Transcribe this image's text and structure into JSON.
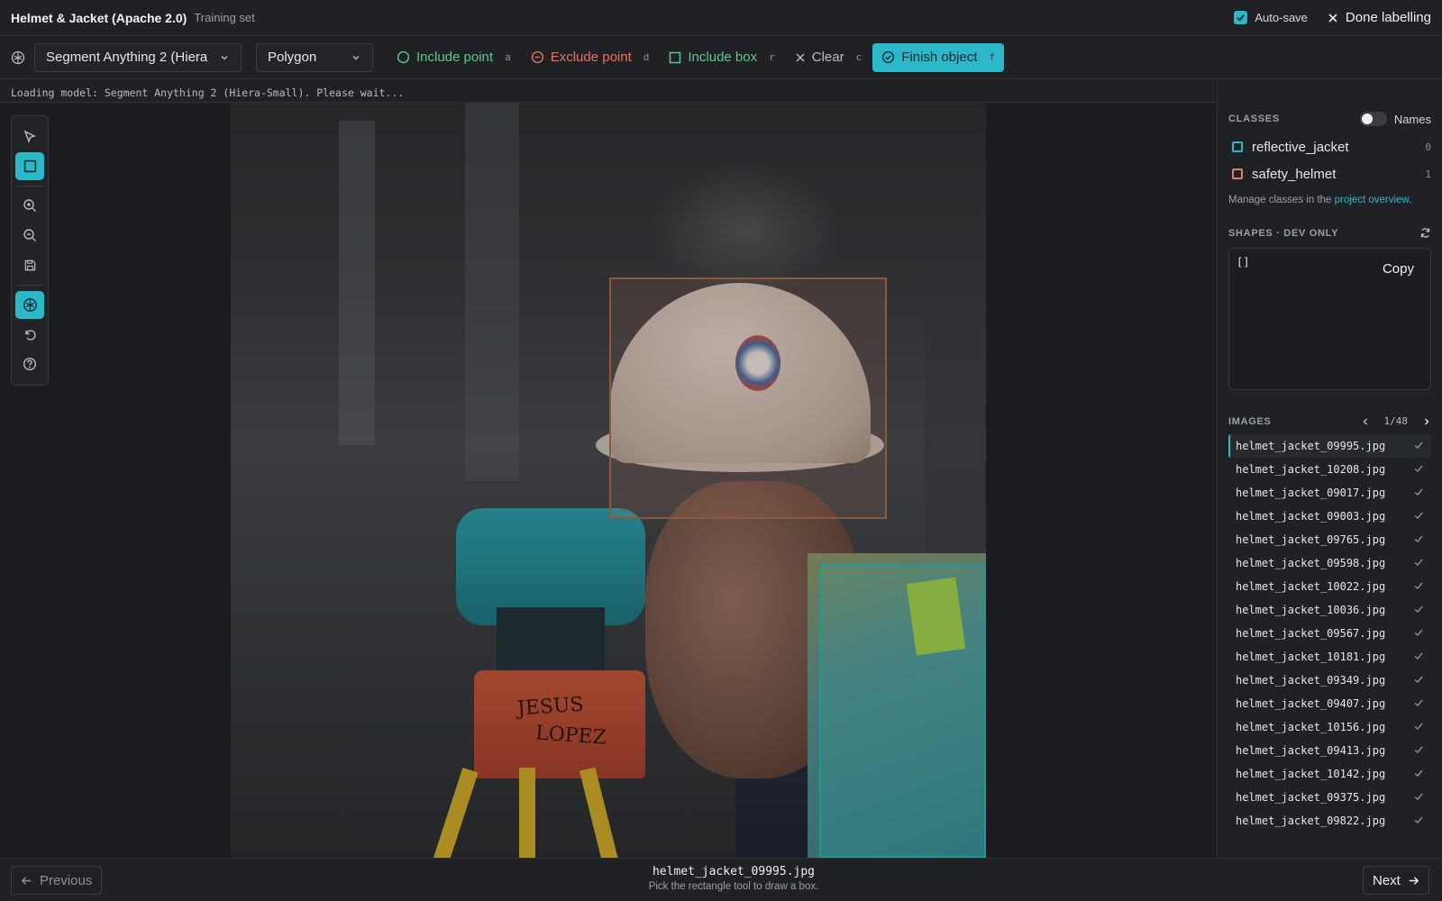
{
  "header": {
    "project": "Helmet & Jacket (Apache 2.0)",
    "subset": "Training set",
    "autosave_label": "Auto-save",
    "done_label": "Done labelling"
  },
  "toolbar": {
    "model_select": "Segment Anything 2 (Hiera",
    "shape_select": "Polygon",
    "include_point": {
      "label": "Include point",
      "key": "a"
    },
    "exclude_point": {
      "label": "Exclude point",
      "key": "d"
    },
    "include_box": {
      "label": "Include box",
      "key": "r"
    },
    "clear": {
      "label": "Clear",
      "key": "c"
    },
    "finish": {
      "label": "Finish object",
      "key": "f"
    }
  },
  "status": "Loading model: Segment Anything 2 (Hiera-Small). Please wait...",
  "classes": {
    "heading": "CLASSES",
    "names_toggle": "Names",
    "items": [
      {
        "name": "reflective_jacket",
        "index": "0",
        "color": "#2bb8c9"
      },
      {
        "name": "safety_helmet",
        "index": "1",
        "color": "#d9826c"
      }
    ],
    "manage_prefix": "Manage classes in the",
    "manage_link": "project overview",
    "manage_suffix": "."
  },
  "shapes": {
    "heading": "SHAPES · DEV ONLY",
    "content": "[]",
    "copy_label": "Copy"
  },
  "images": {
    "heading": "IMAGES",
    "counter": "1/48",
    "items": [
      "helmet_jacket_09995.jpg",
      "helmet_jacket_10208.jpg",
      "helmet_jacket_09017.jpg",
      "helmet_jacket_09003.jpg",
      "helmet_jacket_09765.jpg",
      "helmet_jacket_09598.jpg",
      "helmet_jacket_10022.jpg",
      "helmet_jacket_10036.jpg",
      "helmet_jacket_09567.jpg",
      "helmet_jacket_10181.jpg",
      "helmet_jacket_09349.jpg",
      "helmet_jacket_09407.jpg",
      "helmet_jacket_10156.jpg",
      "helmet_jacket_09413.jpg",
      "helmet_jacket_10142.jpg",
      "helmet_jacket_09375.jpg",
      "helmet_jacket_09822.jpg"
    ]
  },
  "footer": {
    "previous_label": "Previous",
    "next_label": "Next",
    "filename": "helmet_jacket_09995.jpg",
    "hint": "Pick the rectangle tool to draw a box."
  },
  "photo": {
    "tripod_text_1": "JESUS",
    "tripod_text_2": "LOPEZ"
  }
}
